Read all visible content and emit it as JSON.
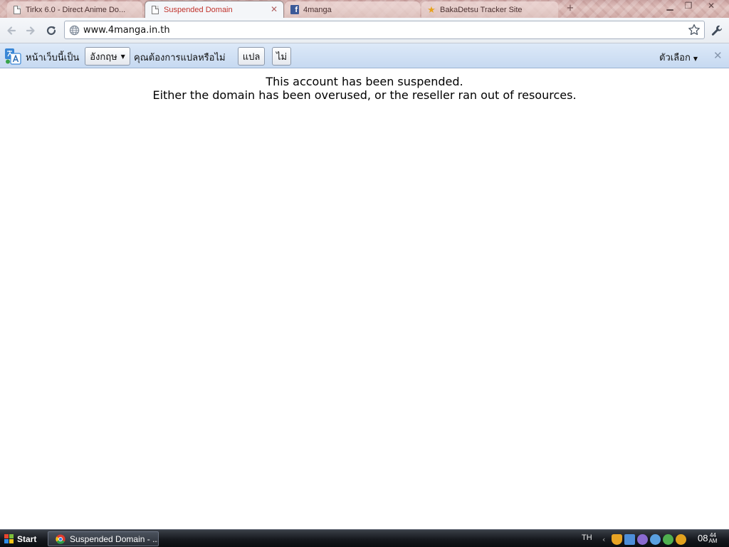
{
  "tabs": [
    {
      "title": "Tirkx 6.0 - Direct Anime Do...",
      "icon": "page-icon",
      "active": false
    },
    {
      "title": "Suspended Domain",
      "icon": "page-icon",
      "active": true
    },
    {
      "title": "4manga",
      "icon": "facebook-icon",
      "active": false
    },
    {
      "title": "BakaDetsu Tracker Site",
      "icon": "star-icon",
      "active": false
    }
  ],
  "toolbar": {
    "url": "www.4manga.in.th"
  },
  "translate_bar": {
    "prefix": "หน้าเว็บนี้เป็น",
    "language": "อังกฤษ",
    "question": "คุณต้องการแปลหรือไม่",
    "translate_label": "แปล",
    "no_label": "ไม่",
    "options_label": "ตัวเลือก"
  },
  "page": {
    "line1": "This account has been suspended.",
    "line2": "Either the domain has been overused, or the reseller ran out of resources."
  },
  "taskbar": {
    "start_label": "Start",
    "task_label": "Suspended Domain - ...",
    "language": "TH",
    "clock_hour": "08",
    "clock_min": "44",
    "clock_ampm": "AM"
  },
  "colors": {
    "active_tab_text": "#c0322c",
    "infobar_bg": "#c6d9f1",
    "taskbar_bg": "#16191e"
  }
}
